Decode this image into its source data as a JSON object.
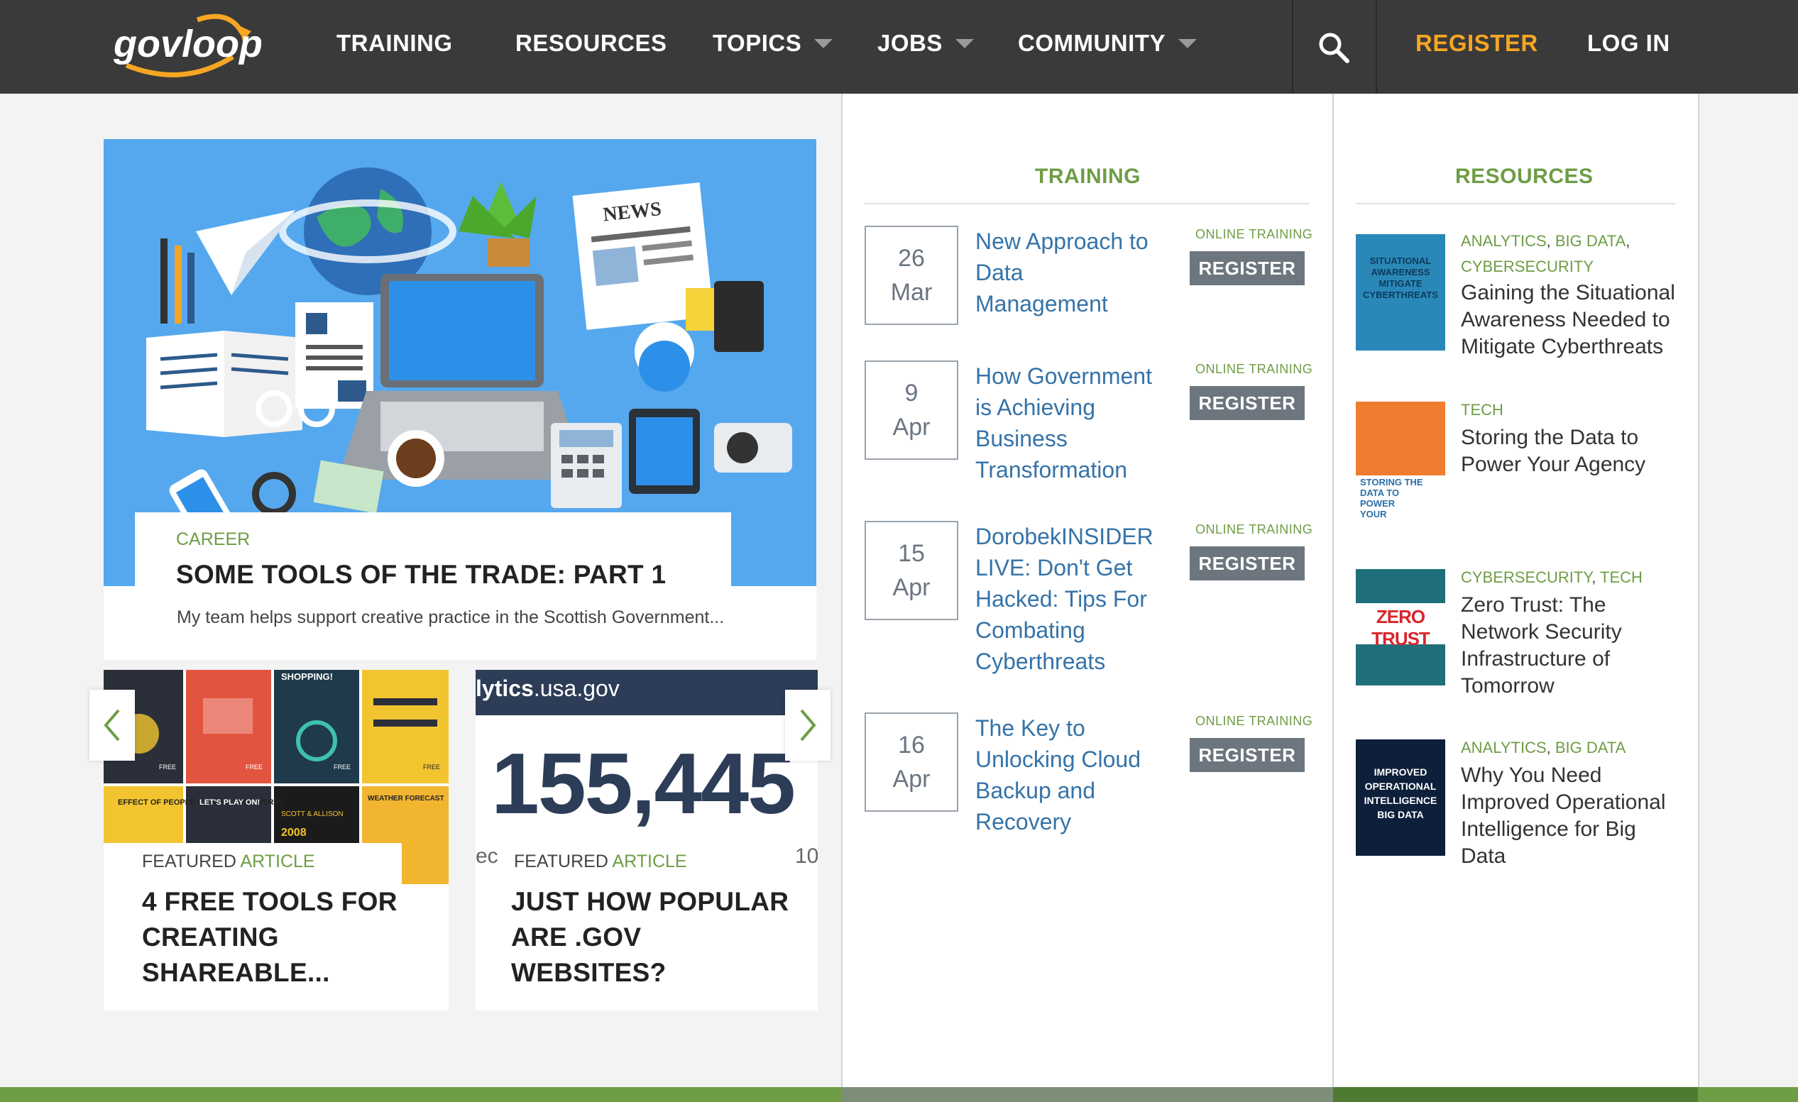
{
  "nav": {
    "logo_text": "govloop",
    "items": [
      {
        "label": "TRAINING"
      },
      {
        "label": "RESOURCES"
      },
      {
        "label": "TOPICS"
      },
      {
        "label": "JOBS"
      },
      {
        "label": "COMMUNITY"
      }
    ],
    "register": "REGISTER",
    "login": "LOG IN"
  },
  "hero": {
    "image_text": "NEWS",
    "category": "CAREER",
    "title": "SOME TOOLS OF THE TRADE: PART 1",
    "excerpt": "My team helps support creative practice in the Scottish Government..."
  },
  "featured": [
    {
      "label_prefix": "FEATURED",
      "label_suffix": "ARTICLE",
      "title": "4 FREE TOOLS FOR CREATING SHAREABLE...",
      "image_texts": [
        "SHOPPING!",
        "EFFECT OF PEOPLE AROUND INTROVERTS",
        "LET'S PLAY ON!",
        "WEATHER FORECAST",
        "FREE",
        "FREE",
        "FREE",
        "FREE",
        "2008",
        "SCOTT & ALLISON"
      ]
    },
    {
      "label_prefix": "FEATURED",
      "label_suffix": "ARTICLE",
      "title": "JUST HOW POPULAR ARE .GOV WEBSITES?",
      "title_tail": "...",
      "image_header_bold": "lytics",
      "image_header_rest": ".usa.gov",
      "image_number": "155,445",
      "image_left_fragment": "ec",
      "image_right_fragment": "10"
    }
  ],
  "training": {
    "heading": "TRAINING",
    "events": [
      {
        "day": "26",
        "month": "Mar",
        "title": "New Approach to Data Management",
        "kind": "ONLINE TRAINING",
        "button": "REGISTER"
      },
      {
        "day": "9",
        "month": "Apr",
        "title": "How Government is Achieving Business Transformation",
        "kind": "ONLINE TRAINING",
        "button": "REGISTER"
      },
      {
        "day": "15",
        "month": "Apr",
        "title": "DorobekINSIDER LIVE: Don't Get Hacked: Tips For Combating Cyberthreats",
        "kind": "ONLINE TRAINING",
        "button": "REGISTER"
      },
      {
        "day": "16",
        "month": "Apr",
        "title": "The Key to Unlocking Cloud Backup and Recovery",
        "kind": "ONLINE TRAINING",
        "button": "REGISTER"
      }
    ]
  },
  "resources": {
    "heading": "RESOURCES",
    "items": [
      {
        "tags": [
          "ANALYTICS",
          "BIG DATA",
          "CYBERSECURITY"
        ],
        "title": "Gaining the Situational Awareness Needed to Mitigate Cyberthreats",
        "thumb_text": "SITUATIONAL AWARENESS MITIGATE CYBERTHREATS",
        "thumb_color": "#2a88b8"
      },
      {
        "tags": [
          "TECH"
        ],
        "title": "Storing the Data to Power Your Agency",
        "thumb_text": "STORING THE DATA TO POWER YOUR AGENCY",
        "thumb_color": "#f07d2f"
      },
      {
        "tags": [
          "CYBERSECURITY",
          "TECH"
        ],
        "title": "Zero Trust: The Network Security Infrastructure of Tomorrow",
        "thumb_text": "ZERO TRUST",
        "thumb_color": "#1f6f7a"
      },
      {
        "tags": [
          "ANALYTICS",
          "BIG DATA"
        ],
        "title": "Why You Need Improved Operational Intelligence for Big Data",
        "thumb_text": "IMPROVED OPERATIONAL INTELLIGENCE BIG DATA",
        "thumb_color": "#0d1f3a"
      }
    ]
  },
  "colors": {
    "nav_bg": "#3a3a3a",
    "accent_green": "#6e9d45",
    "register_orange": "#f6a623",
    "link_blue": "#3573a8"
  }
}
